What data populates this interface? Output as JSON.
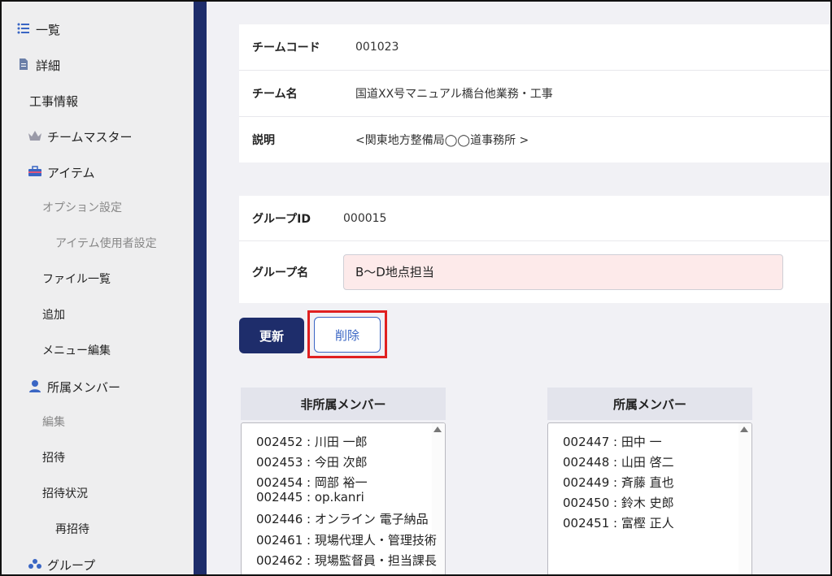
{
  "sidebar": {
    "items": [
      {
        "label": "一覧",
        "icon": "list-icon"
      },
      {
        "label": "詳細",
        "icon": "document-icon"
      },
      {
        "label": "工事情報"
      },
      {
        "label": "チームマスター",
        "icon": "crown-icon"
      },
      {
        "label": "アイテム",
        "icon": "toolbox-icon"
      },
      {
        "label": "オプション設定"
      },
      {
        "label": "アイテム使用者設定"
      },
      {
        "label": "ファイル一覧"
      },
      {
        "label": "追加"
      },
      {
        "label": "メニュー編集"
      },
      {
        "label": "所属メンバー",
        "icon": "user-icon"
      },
      {
        "label": "編集"
      },
      {
        "label": "招待"
      },
      {
        "label": "招待状況"
      },
      {
        "label": "再招待"
      },
      {
        "label": "グループ",
        "icon": "group-icon"
      }
    ]
  },
  "team": {
    "code_label": "チームコード",
    "code_value": "001023",
    "name_label": "チーム名",
    "name_value": "国道XX号マニュアル橋台他業務・工事",
    "desc_label": "説明",
    "desc_value": "<関東地方整備局◯◯道事務所 >"
  },
  "group": {
    "id_label": "グループID",
    "id_value": "000015",
    "name_label": "グループ名",
    "name_value": "B〜D地点担当"
  },
  "actions": {
    "update_label": "更新",
    "delete_label": "削除"
  },
  "non_members": {
    "header": "非所属メンバー",
    "items": [
      "002452 : 川田 一郎",
      "002453 : 今田 次郎",
      "002454 : 岡部 裕一",
      "002445 : op.kanri",
      "002446 : オンライン 電子納品",
      "002461 : 現場代理人・管理技術",
      "002462 : 現場監督員・担当課長"
    ]
  },
  "members": {
    "header": "所属メンバー",
    "items": [
      "002447 : 田中 一",
      "002448 : 山田 啓二",
      "002449 : 斉藤 直也",
      "002450 : 鈴木 史郎",
      "002451 : 富樫 正人"
    ]
  },
  "colors": {
    "navy": "#1e2d6b",
    "highlight_red": "#e02020",
    "input_pink": "#fdeaea",
    "link_blue": "#3a66c4"
  }
}
